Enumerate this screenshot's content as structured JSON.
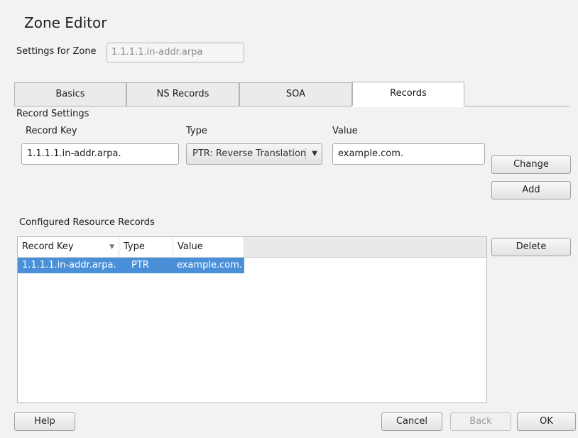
{
  "window": {
    "title": "Zone Editor"
  },
  "zone": {
    "label": "Settings for Zone",
    "value": "1.1.1.1.in-addr.arpa"
  },
  "tabs": [
    {
      "label": "Basics"
    },
    {
      "label": "NS Records"
    },
    {
      "label": "SOA"
    },
    {
      "label": "Records"
    }
  ],
  "record_settings": {
    "group_label": "Record Settings",
    "key_label": "Record Key",
    "type_label": "Type",
    "value_label": "Value",
    "key_value": "1.1.1.1.in-addr.arpa.",
    "type_value": "PTR: Reverse Translation",
    "value_value": "example.com."
  },
  "buttons": {
    "change": "Change",
    "add": "Add",
    "delete": "Delete",
    "help": "Help",
    "cancel": "Cancel",
    "back": "Back",
    "ok": "OK"
  },
  "records_table": {
    "label": "Configured Resource Records",
    "columns": [
      "Record Key",
      "Type",
      "Value"
    ],
    "rows": [
      [
        "1.1.1.1.in-addr.arpa.",
        "PTR",
        "example.com."
      ]
    ],
    "selected_row": 0
  },
  "colors": {
    "selection": "#4a90d9",
    "background": "#f2f2f2"
  }
}
